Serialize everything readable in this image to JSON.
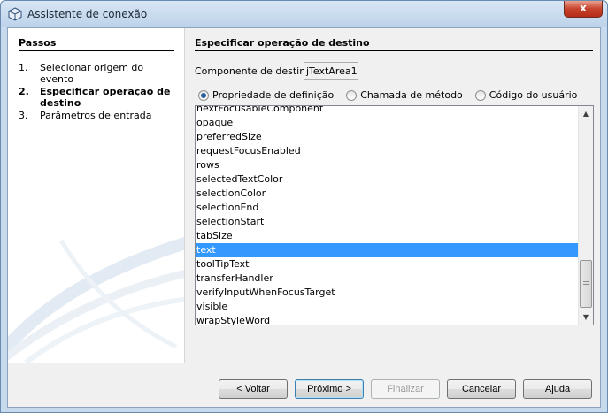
{
  "window": {
    "title": "Assistente de conexão",
    "close_glyph": "x"
  },
  "steps_panel": {
    "title": "Passos",
    "steps": [
      {
        "num": "1.",
        "label": "Selecionar origem do evento",
        "current": false
      },
      {
        "num": "2.",
        "label": "Especificar operação de destino",
        "current": true
      },
      {
        "num": "3.",
        "label": "Parâmetros de entrada",
        "current": false
      }
    ]
  },
  "main": {
    "title": "Especificar operação de destino",
    "component_label": "Componente de destino:",
    "component_value": "jTextArea1",
    "radio_options": [
      {
        "label": "Propriedade de definição",
        "selected": true
      },
      {
        "label": "Chamada de método",
        "selected": false
      },
      {
        "label": "Código do usuário",
        "selected": false
      }
    ],
    "list_items": [
      "nextFocusableComponent",
      "opaque",
      "preferredSize",
      "requestFocusEnabled",
      "rows",
      "selectedTextColor",
      "selectionColor",
      "selectionEnd",
      "selectionStart",
      "tabSize",
      "text",
      "toolTipText",
      "transferHandler",
      "verifyInputWhenFocusTarget",
      "visible",
      "wrapStyleWord"
    ],
    "selected_item": "text"
  },
  "buttons": {
    "back": "< Voltar",
    "next": "Próximo >",
    "finish": "Finalizar",
    "cancel": "Cancelar",
    "help": "Ajuda"
  },
  "colors": {
    "selection": "#3399ff",
    "close": "#c7422c"
  }
}
